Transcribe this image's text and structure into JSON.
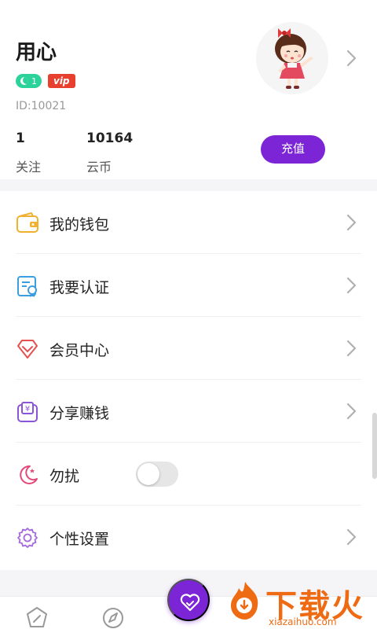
{
  "profile": {
    "username": "用心",
    "level": "1",
    "vip_label": "vip",
    "user_id": "ID:10021",
    "stats": [
      {
        "value": "1",
        "label": "关注"
      },
      {
        "value": "10164",
        "label": "云币"
      }
    ],
    "recharge_label": "充值"
  },
  "menu": [
    {
      "label": "我的钱包",
      "icon": "wallet-icon"
    },
    {
      "label": "我要认证",
      "icon": "certificate-icon"
    },
    {
      "label": "会员中心",
      "icon": "diamond-icon"
    },
    {
      "label": "分享赚钱",
      "icon": "yen-share-icon"
    },
    {
      "label": "勿扰",
      "icon": "moon-icon",
      "toggle_on": false
    },
    {
      "label": "个性设置",
      "icon": "gear-icon"
    }
  ],
  "watermark": {
    "text": "下载火",
    "domain": "xiazaihuo.com"
  },
  "colors": {
    "accent": "#7b25d6",
    "level_badge": "#2bd39a",
    "vip_badge": "#e8402f",
    "watermark": "#ee6b14"
  }
}
